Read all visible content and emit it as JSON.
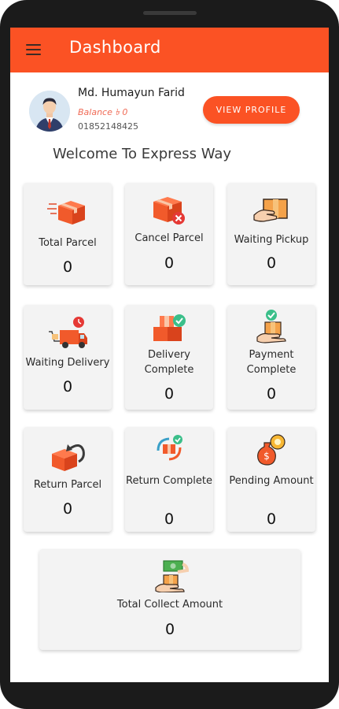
{
  "appbar": {
    "title": "Dashboard"
  },
  "user": {
    "name": "Md. Humayun Farid",
    "balance": "Balance ৳ 0",
    "phone": "01852148425"
  },
  "profile_button": {
    "label": "VIEW PROFILE"
  },
  "welcome": "Welcome To Express Way",
  "colors": {
    "accent": "#fb5224"
  },
  "cards": [
    {
      "label": "Total Parcel",
      "value": "0",
      "icon": "parcel-box-icon"
    },
    {
      "label": "Cancel Parcel",
      "value": "0",
      "icon": "cancel-box-icon"
    },
    {
      "label": "Waiting Pickup",
      "value": "0",
      "icon": "hand-box-icon"
    },
    {
      "label": "Waiting Delivery",
      "value": "0",
      "icon": "delivery-truck-icon"
    },
    {
      "label": "Delivery Complete",
      "value": "0",
      "icon": "boxes-check-icon"
    },
    {
      "label": "Payment Complete",
      "value": "0",
      "icon": "hand-payment-check-icon"
    },
    {
      "label": "Return Parcel",
      "value": "0",
      "icon": "return-box-icon"
    },
    {
      "label": "Return Complete",
      "value": "0",
      "icon": "return-check-icon"
    },
    {
      "label": "Pending Amount",
      "value": "0",
      "icon": "money-bag-gear-icon"
    }
  ],
  "total_collect": {
    "label": "Total Collect Amount",
    "value": "0",
    "icon": "collect-money-icon"
  }
}
